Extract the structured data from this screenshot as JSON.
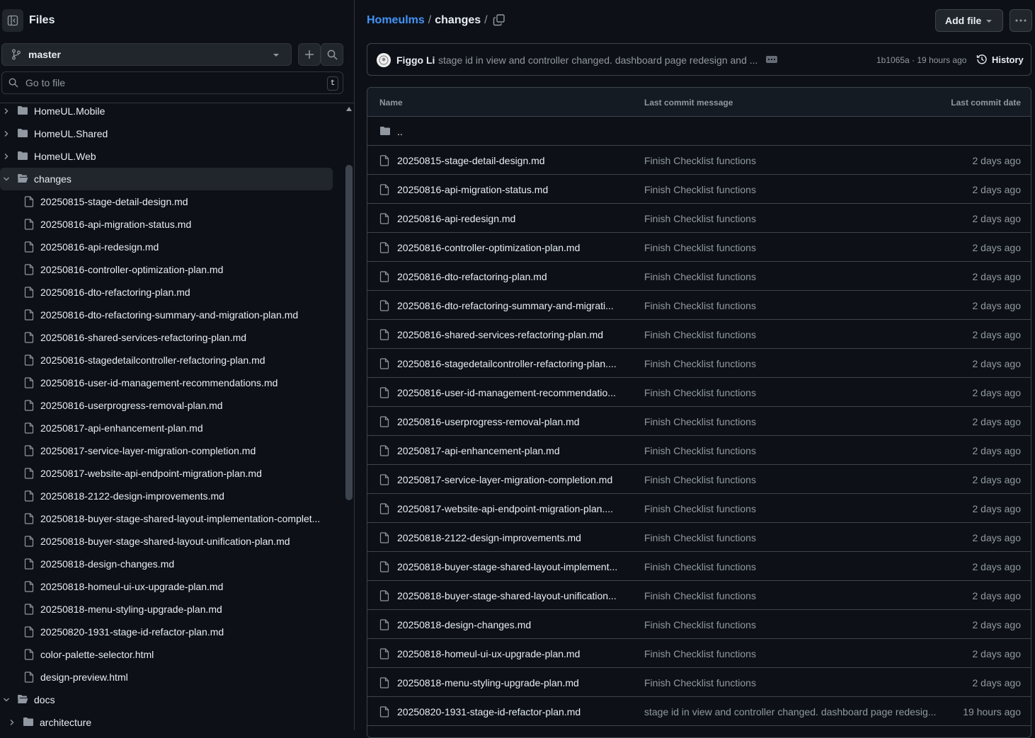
{
  "sidebar": {
    "title": "Files",
    "branch": "master",
    "search_placeholder": "Go to file",
    "search_shortcut": "t",
    "tree": [
      {
        "type": "folder",
        "label": "HomeUL.Mobile",
        "depth": 0,
        "expanded": false
      },
      {
        "type": "folder",
        "label": "HomeUL.Shared",
        "depth": 0,
        "expanded": false
      },
      {
        "type": "folder",
        "label": "HomeUL.Web",
        "depth": 0,
        "expanded": false
      },
      {
        "type": "folder",
        "label": "changes",
        "depth": 0,
        "expanded": true,
        "selected": true
      },
      {
        "type": "file",
        "label": "20250815-stage-detail-design.md",
        "depth": 1
      },
      {
        "type": "file",
        "label": "20250816-api-migration-status.md",
        "depth": 1
      },
      {
        "type": "file",
        "label": "20250816-api-redesign.md",
        "depth": 1
      },
      {
        "type": "file",
        "label": "20250816-controller-optimization-plan.md",
        "depth": 1
      },
      {
        "type": "file",
        "label": "20250816-dto-refactoring-plan.md",
        "depth": 1
      },
      {
        "type": "file",
        "label": "20250816-dto-refactoring-summary-and-migration-plan.md",
        "depth": 1
      },
      {
        "type": "file",
        "label": "20250816-shared-services-refactoring-plan.md",
        "depth": 1
      },
      {
        "type": "file",
        "label": "20250816-stagedetailcontroller-refactoring-plan.md",
        "depth": 1
      },
      {
        "type": "file",
        "label": "20250816-user-id-management-recommendations.md",
        "depth": 1
      },
      {
        "type": "file",
        "label": "20250816-userprogress-removal-plan.md",
        "depth": 1
      },
      {
        "type": "file",
        "label": "20250817-api-enhancement-plan.md",
        "depth": 1
      },
      {
        "type": "file",
        "label": "20250817-service-layer-migration-completion.md",
        "depth": 1
      },
      {
        "type": "file",
        "label": "20250817-website-api-endpoint-migration-plan.md",
        "depth": 1
      },
      {
        "type": "file",
        "label": "20250818-2122-design-improvements.md",
        "depth": 1
      },
      {
        "type": "file",
        "label": "20250818-buyer-stage-shared-layout-implementation-complet...",
        "depth": 1
      },
      {
        "type": "file",
        "label": "20250818-buyer-stage-shared-layout-unification-plan.md",
        "depth": 1
      },
      {
        "type": "file",
        "label": "20250818-design-changes.md",
        "depth": 1
      },
      {
        "type": "file",
        "label": "20250818-homeul-ui-ux-upgrade-plan.md",
        "depth": 1
      },
      {
        "type": "file",
        "label": "20250818-menu-styling-upgrade-plan.md",
        "depth": 1
      },
      {
        "type": "file",
        "label": "20250820-1931-stage-id-refactor-plan.md",
        "depth": 1
      },
      {
        "type": "file",
        "label": "color-palette-selector.html",
        "depth": 1
      },
      {
        "type": "file",
        "label": "design-preview.html",
        "depth": 1
      },
      {
        "type": "folder",
        "label": "docs",
        "depth": 0,
        "expanded": true
      },
      {
        "type": "folder",
        "label": "architecture",
        "depth": 1,
        "expanded": false
      }
    ]
  },
  "header": {
    "repo": "Homeulms",
    "sep1": "/",
    "current": "changes",
    "sep2": "/",
    "add_file": "Add file"
  },
  "commit": {
    "author": "Figgo Li",
    "message": "stage id in view and controller changed. dashboard page redesign and ...",
    "hash_time": "1b1065a · 19 hours ago",
    "history": "History"
  },
  "table": {
    "col_name": "Name",
    "col_msg": "Last commit message",
    "col_date": "Last commit date",
    "parent": "..",
    "rows": [
      {
        "name": "20250815-stage-detail-design.md",
        "msg": "Finish Checklist functions",
        "date": "2 days ago"
      },
      {
        "name": "20250816-api-migration-status.md",
        "msg": "Finish Checklist functions",
        "date": "2 days ago"
      },
      {
        "name": "20250816-api-redesign.md",
        "msg": "Finish Checklist functions",
        "date": "2 days ago"
      },
      {
        "name": "20250816-controller-optimization-plan.md",
        "msg": "Finish Checklist functions",
        "date": "2 days ago"
      },
      {
        "name": "20250816-dto-refactoring-plan.md",
        "msg": "Finish Checklist functions",
        "date": "2 days ago"
      },
      {
        "name": "20250816-dto-refactoring-summary-and-migrati...",
        "msg": "Finish Checklist functions",
        "date": "2 days ago"
      },
      {
        "name": "20250816-shared-services-refactoring-plan.md",
        "msg": "Finish Checklist functions",
        "date": "2 days ago"
      },
      {
        "name": "20250816-stagedetailcontroller-refactoring-plan....",
        "msg": "Finish Checklist functions",
        "date": "2 days ago"
      },
      {
        "name": "20250816-user-id-management-recommendatio...",
        "msg": "Finish Checklist functions",
        "date": "2 days ago"
      },
      {
        "name": "20250816-userprogress-removal-plan.md",
        "msg": "Finish Checklist functions",
        "date": "2 days ago"
      },
      {
        "name": "20250817-api-enhancement-plan.md",
        "msg": "Finish Checklist functions",
        "date": "2 days ago"
      },
      {
        "name": "20250817-service-layer-migration-completion.md",
        "msg": "Finish Checklist functions",
        "date": "2 days ago"
      },
      {
        "name": "20250817-website-api-endpoint-migration-plan....",
        "msg": "Finish Checklist functions",
        "date": "2 days ago"
      },
      {
        "name": "20250818-2122-design-improvements.md",
        "msg": "Finish Checklist functions",
        "date": "2 days ago"
      },
      {
        "name": "20250818-buyer-stage-shared-layout-implement...",
        "msg": "Finish Checklist functions",
        "date": "2 days ago"
      },
      {
        "name": "20250818-buyer-stage-shared-layout-unification...",
        "msg": "Finish Checklist functions",
        "date": "2 days ago"
      },
      {
        "name": "20250818-design-changes.md",
        "msg": "Finish Checklist functions",
        "date": "2 days ago"
      },
      {
        "name": "20250818-homeul-ui-ux-upgrade-plan.md",
        "msg": "Finish Checklist functions",
        "date": "2 days ago"
      },
      {
        "name": "20250818-menu-styling-upgrade-plan.md",
        "msg": "Finish Checklist functions",
        "date": "2 days ago"
      },
      {
        "name": "20250820-1931-stage-id-refactor-plan.md",
        "msg": "stage id in view and controller changed. dashboard page redesig...",
        "date": "19 hours ago"
      }
    ]
  },
  "colors": {
    "background": "#0d1117",
    "link": "#4493f8",
    "muted": "#9198a1",
    "border": "#3d444d",
    "button": "#21262d"
  }
}
